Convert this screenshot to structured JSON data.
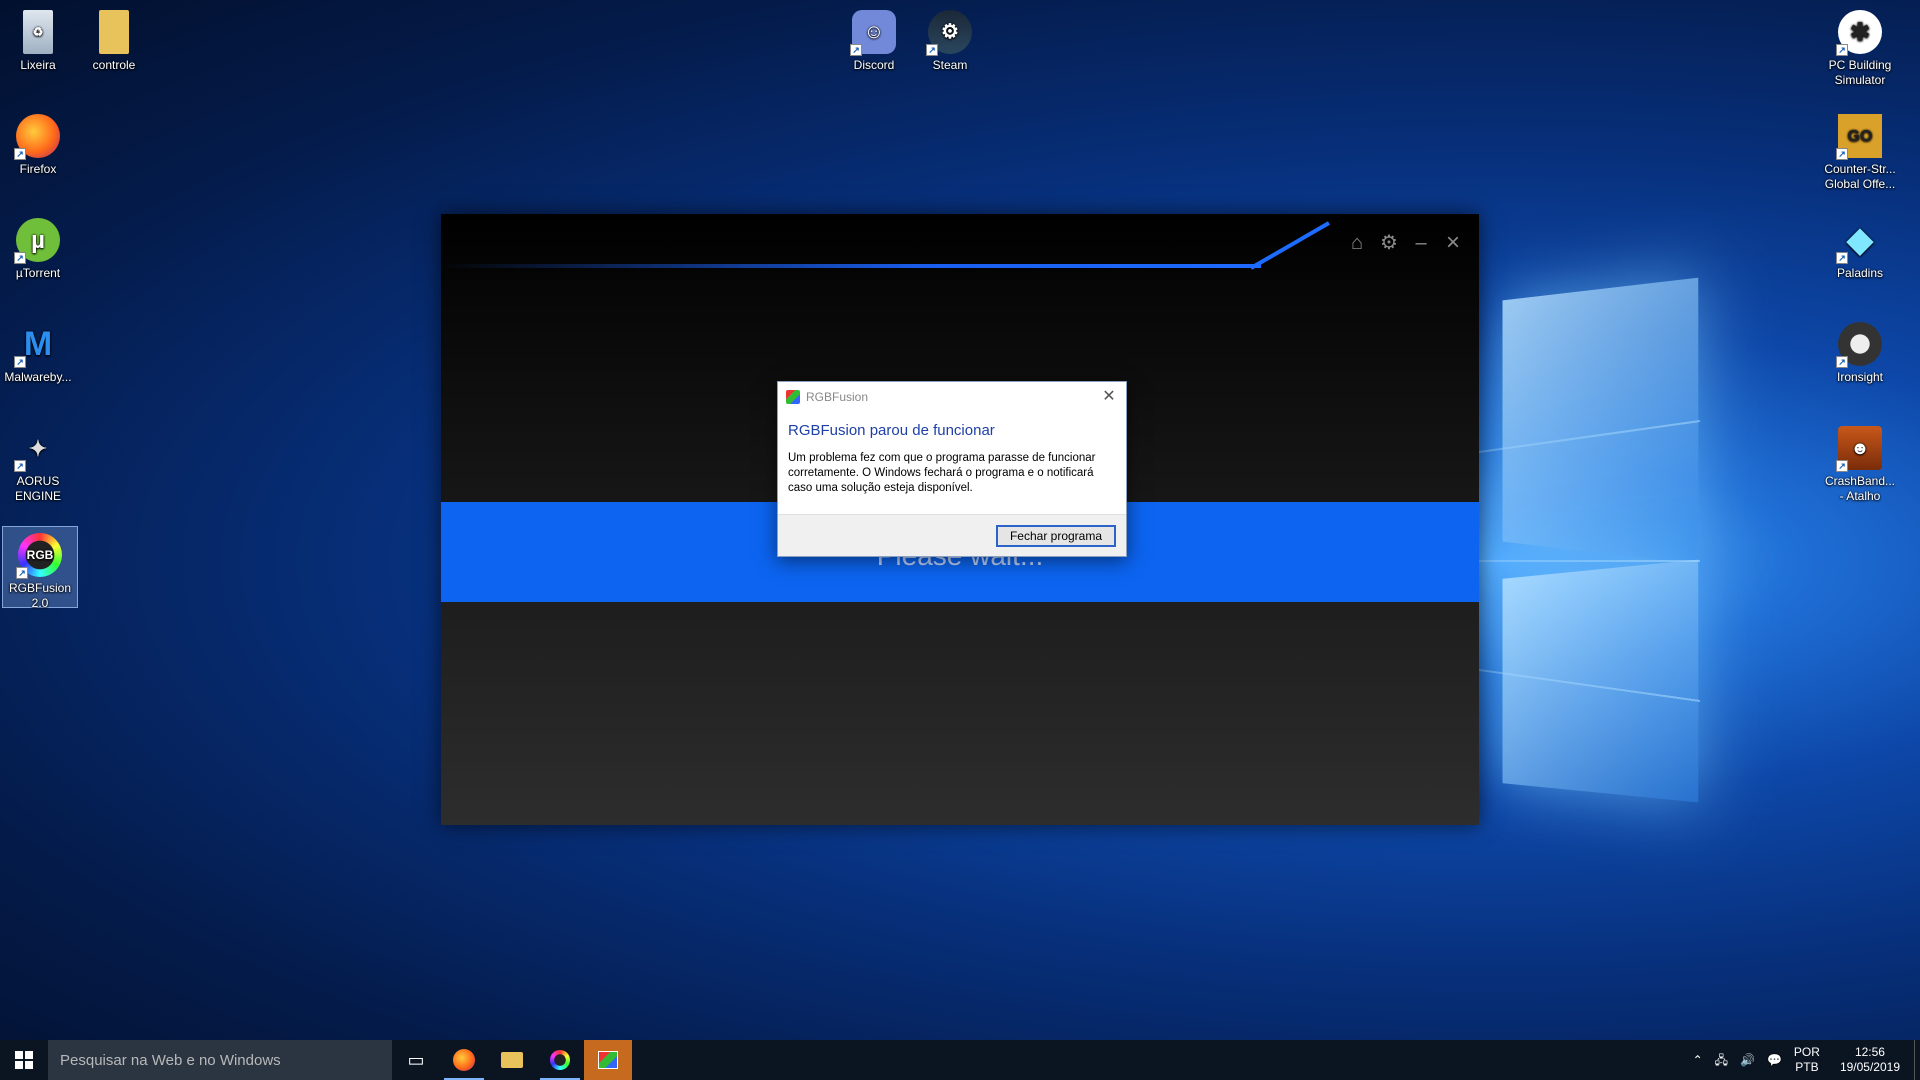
{
  "desktop": {
    "left_icons": [
      {
        "label": "Lixeira",
        "icon": "recycle-bin-icon"
      },
      {
        "label": "controle",
        "icon": "folder-icon"
      },
      {
        "label": "Firefox",
        "icon": "firefox-icon"
      },
      {
        "label": "µTorrent",
        "icon": "utorrent-icon"
      },
      {
        "label": "Malwareby...",
        "icon": "malwarebytes-icon"
      },
      {
        "label": "AORUS ENGINE",
        "icon": "aorus-icon"
      },
      {
        "label": "RGBFusion 2.0",
        "icon": "rgbfusion-icon"
      }
    ],
    "top_icons": [
      {
        "label": "Discord",
        "icon": "discord-icon"
      },
      {
        "label": "Steam",
        "icon": "steam-icon"
      }
    ],
    "right_icons": [
      {
        "label": "PC Building Simulator",
        "icon": "pc-building-simulator-icon"
      },
      {
        "label": "Counter-Str... Global Offe...",
        "icon": "csgo-icon"
      },
      {
        "label": "Paladins",
        "icon": "paladins-icon"
      },
      {
        "label": "Ironsight",
        "icon": "ironsight-icon"
      },
      {
        "label": "CrashBand... - Atalho",
        "icon": "crash-bandicoot-icon"
      }
    ]
  },
  "app_window": {
    "wait_text": "Please wait...",
    "controls": [
      "home-icon",
      "gear-icon",
      "minimize-icon",
      "close-icon"
    ]
  },
  "dialog": {
    "title": "RGBFusion",
    "heading": "RGBFusion parou de funcionar",
    "message": "Um problema fez com que o programa parasse de funcionar corretamente. O Windows fechará o programa e o notificará caso uma solução esteja disponível.",
    "button": "Fechar programa"
  },
  "taskbar": {
    "search_placeholder": "Pesquisar na Web e no Windows",
    "language_top": "POR",
    "language_bottom": "PTB",
    "time": "12:56",
    "date": "19/05/2019"
  },
  "colors": {
    "accent": "#0c64f0",
    "dialog_heading": "#1e3fa8",
    "taskbar_highlight": "#c56a1e"
  }
}
